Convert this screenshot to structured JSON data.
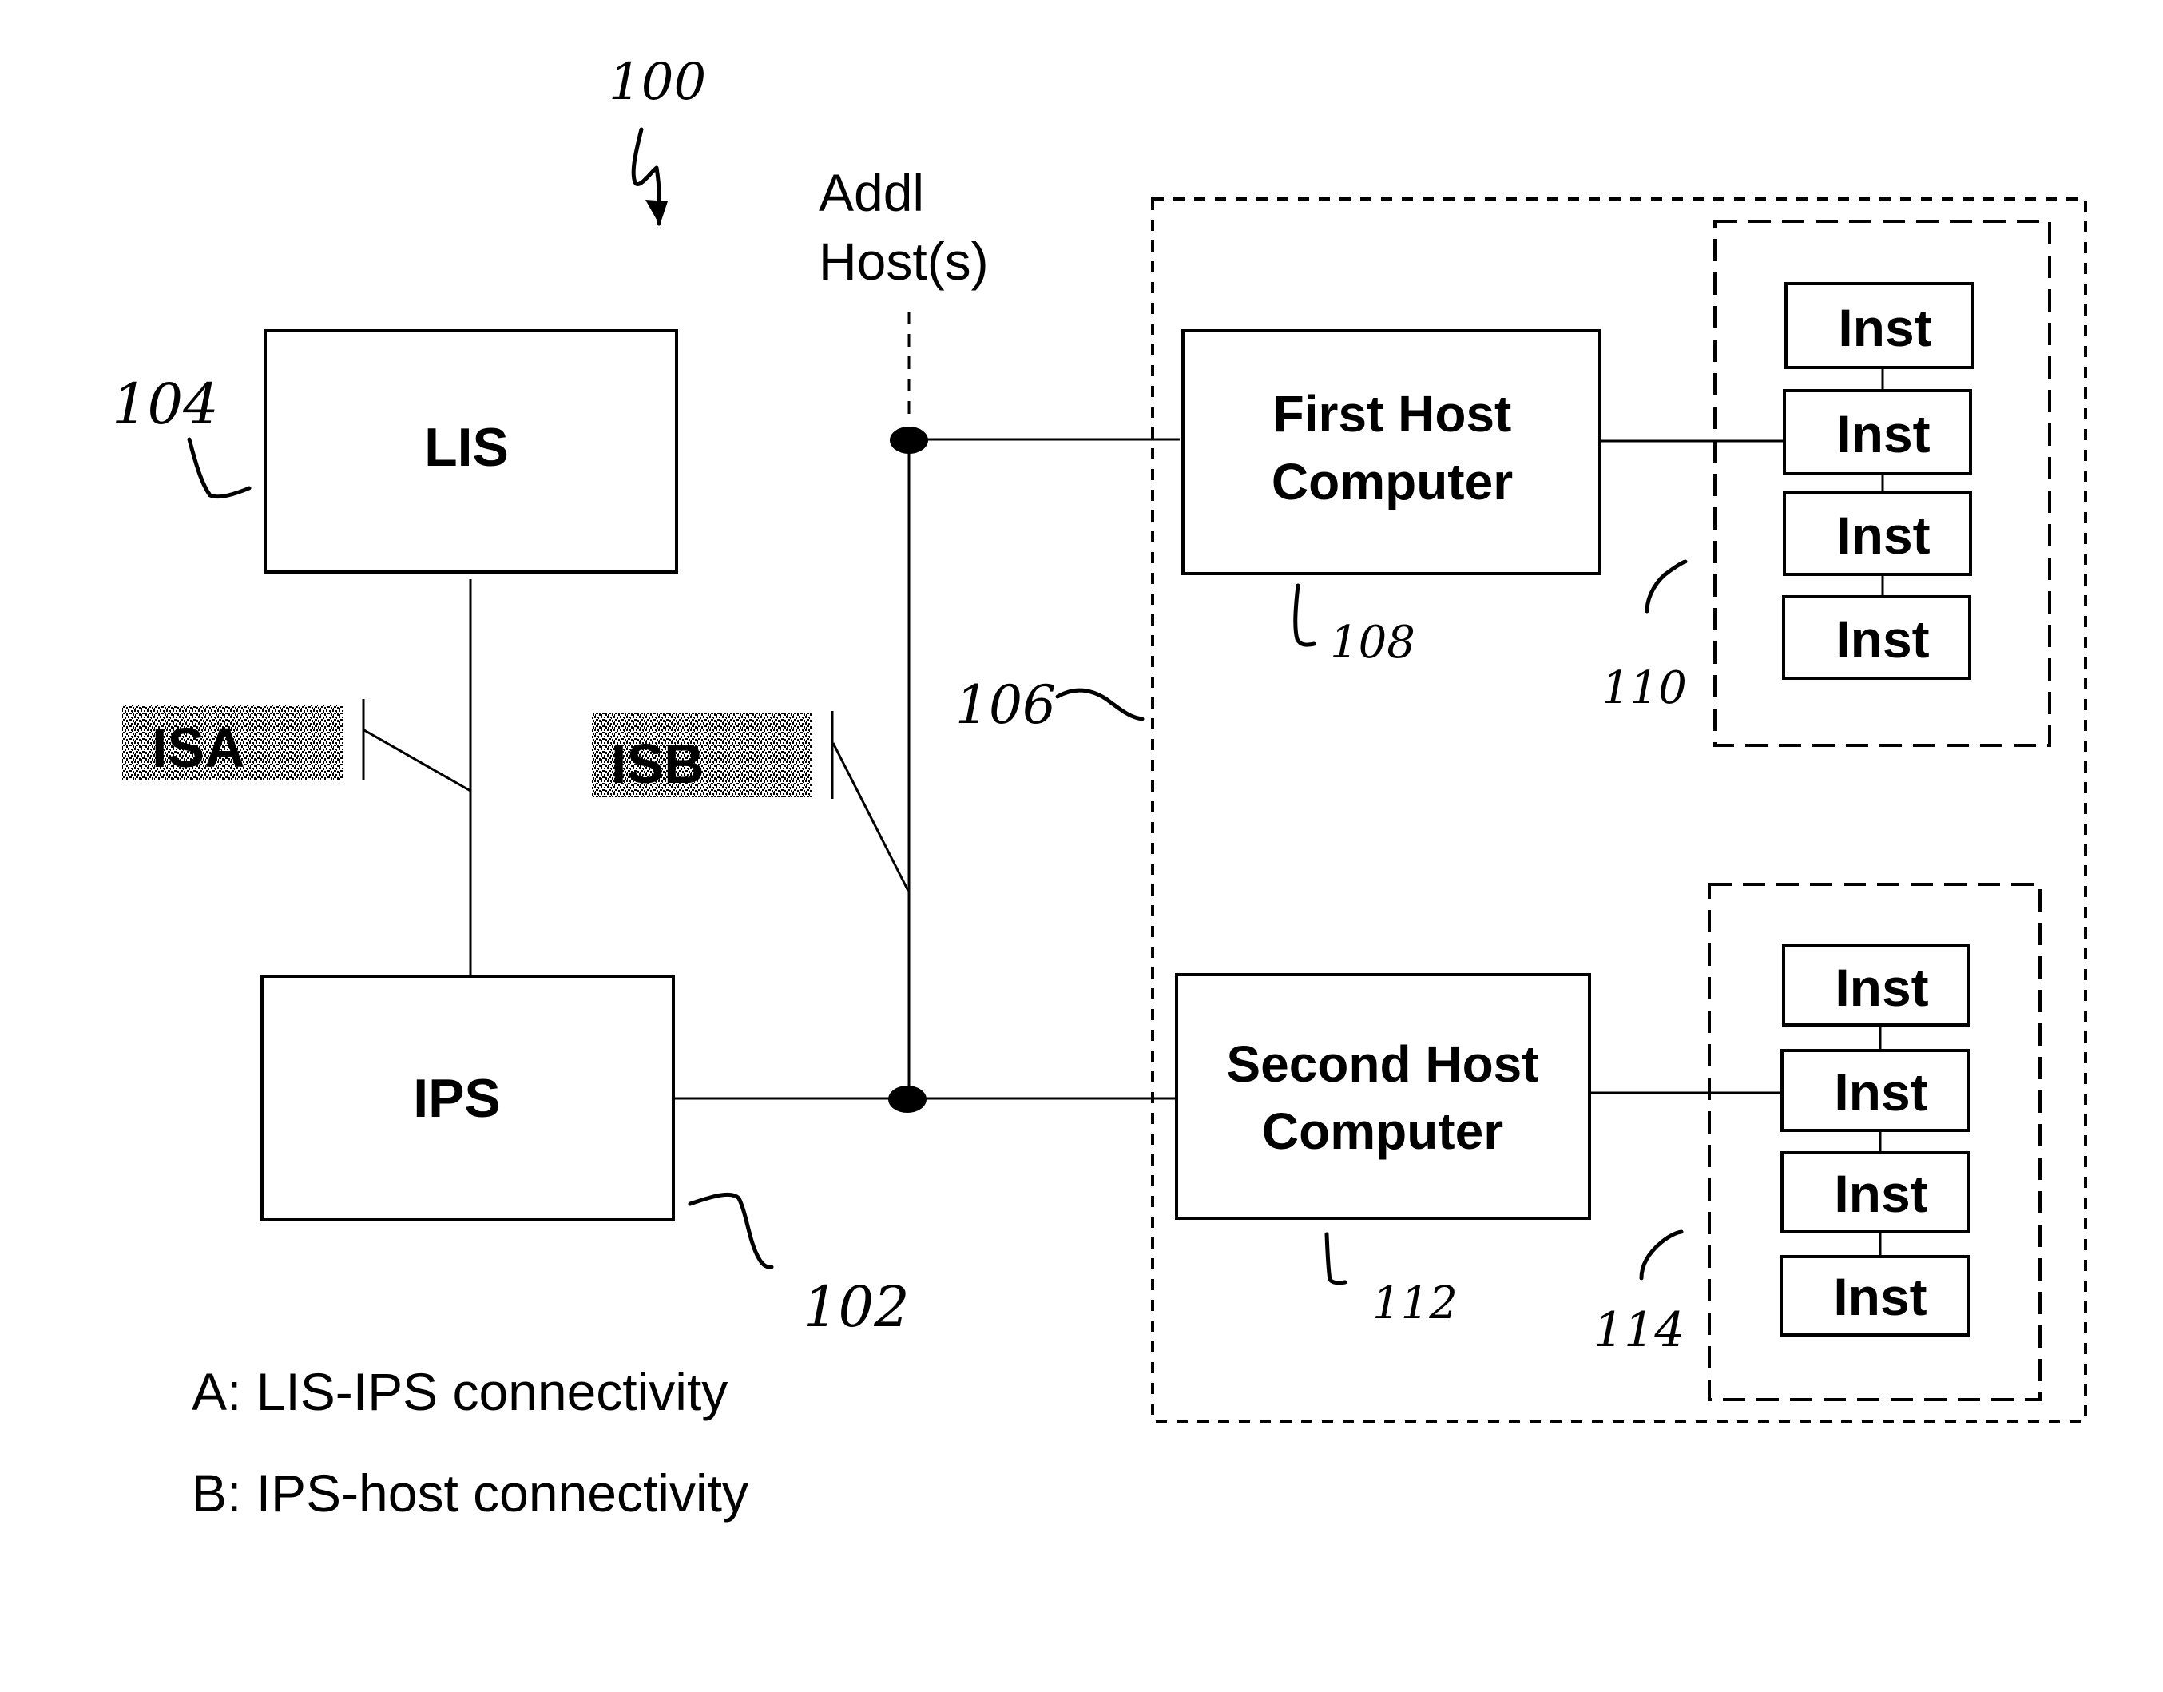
{
  "figure": {
    "reference_number": "100",
    "addl_hosts_label": [
      "Addl",
      "Host(s)"
    ],
    "colors": {
      "ink": "#000000",
      "background": "#ffffff",
      "stipple": "#7a7a7a"
    }
  },
  "nodes": {
    "lis": {
      "label": "LIS",
      "ref": "104"
    },
    "ips": {
      "label": "IPS",
      "ref": "102"
    },
    "host_group": {
      "ref": "106"
    },
    "first_host": {
      "label_lines": [
        "First Host",
        "Computer"
      ],
      "ref": "108"
    },
    "first_instances": {
      "ref": "110",
      "items": [
        "Inst",
        "Inst",
        "Inst",
        "Inst"
      ]
    },
    "second_host": {
      "label_lines": [
        "Second Host",
        "Computer"
      ],
      "ref": "112"
    },
    "second_instances": {
      "ref": "114",
      "items": [
        "Inst",
        "Inst",
        "Inst",
        "Inst"
      ]
    }
  },
  "interface_markers": {
    "a": {
      "label_prefix": "IS",
      "label_suffix": "A"
    },
    "b": {
      "label_prefix": "IS",
      "label_suffix": "B"
    }
  },
  "legend": [
    "A: LIS-IPS connectivity",
    "B: IPS-host connectivity"
  ]
}
